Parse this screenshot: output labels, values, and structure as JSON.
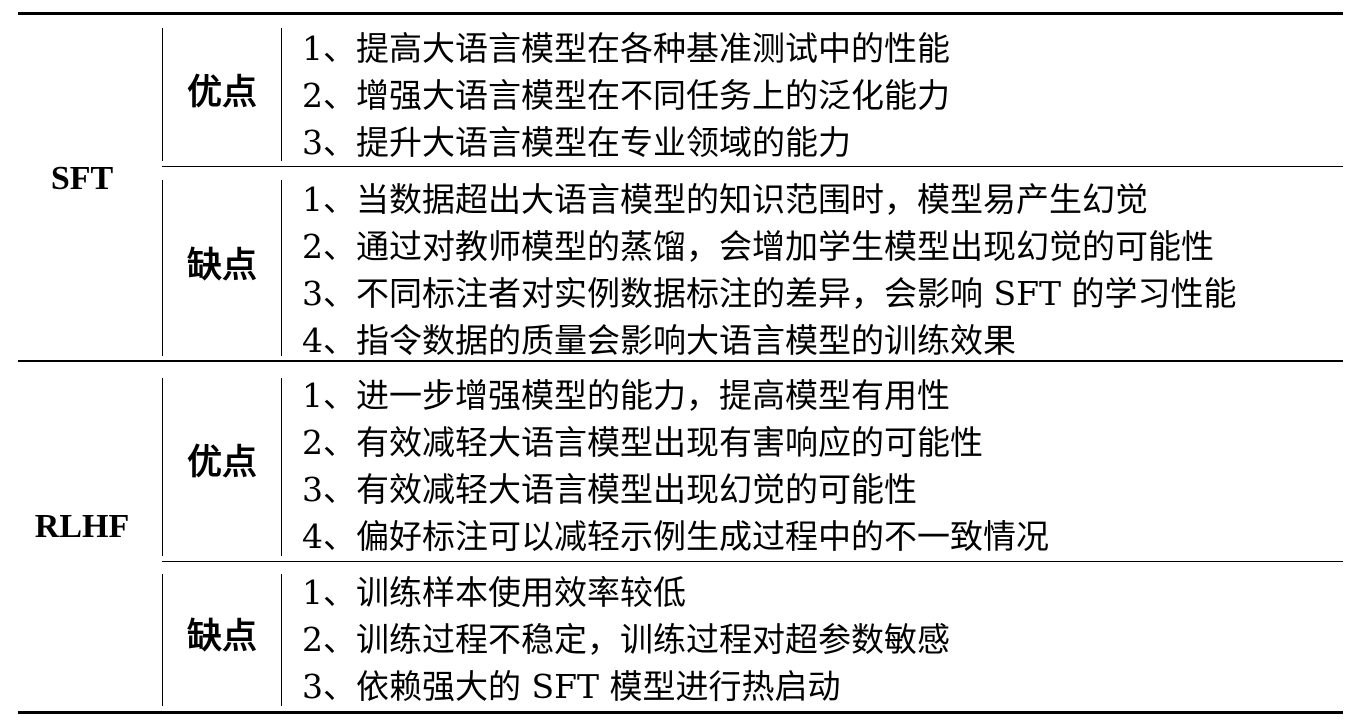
{
  "sections": [
    {
      "name": "SFT",
      "groups": [
        {
          "label": "优点",
          "items": [
            "1、提高大语言模型在各种基准测试中的性能",
            "2、增强大语言模型在不同任务上的泛化能力",
            "3、提升大语言模型在专业领域的能力"
          ]
        },
        {
          "label": "缺点",
          "items": [
            "1、当数据超出大语言模型的知识范围时，模型易产生幻觉",
            "2、通过对教师模型的蒸馏，会增加学生模型出现幻觉的可能性",
            "3、不同标注者对实例数据标注的差异，会影响 SFT 的学习性能",
            "4、指令数据的质量会影响大语言模型的训练效果"
          ]
        }
      ]
    },
    {
      "name": "RLHF",
      "groups": [
        {
          "label": "优点",
          "items": [
            "1、进一步增强模型的能力，提高模型有用性",
            "2、有效减轻大语言模型出现有害响应的可能性",
            "3、有效减轻大语言模型出现幻觉的可能性",
            "4、偏好标注可以减轻示例生成过程中的不一致情况"
          ]
        },
        {
          "label": "缺点",
          "items": [
            "1、训练样本使用效率较低",
            "2、训练过程不稳定，训练过程对超参数敏感",
            "3、依赖强大的 SFT 模型进行热启动"
          ]
        }
      ]
    }
  ]
}
